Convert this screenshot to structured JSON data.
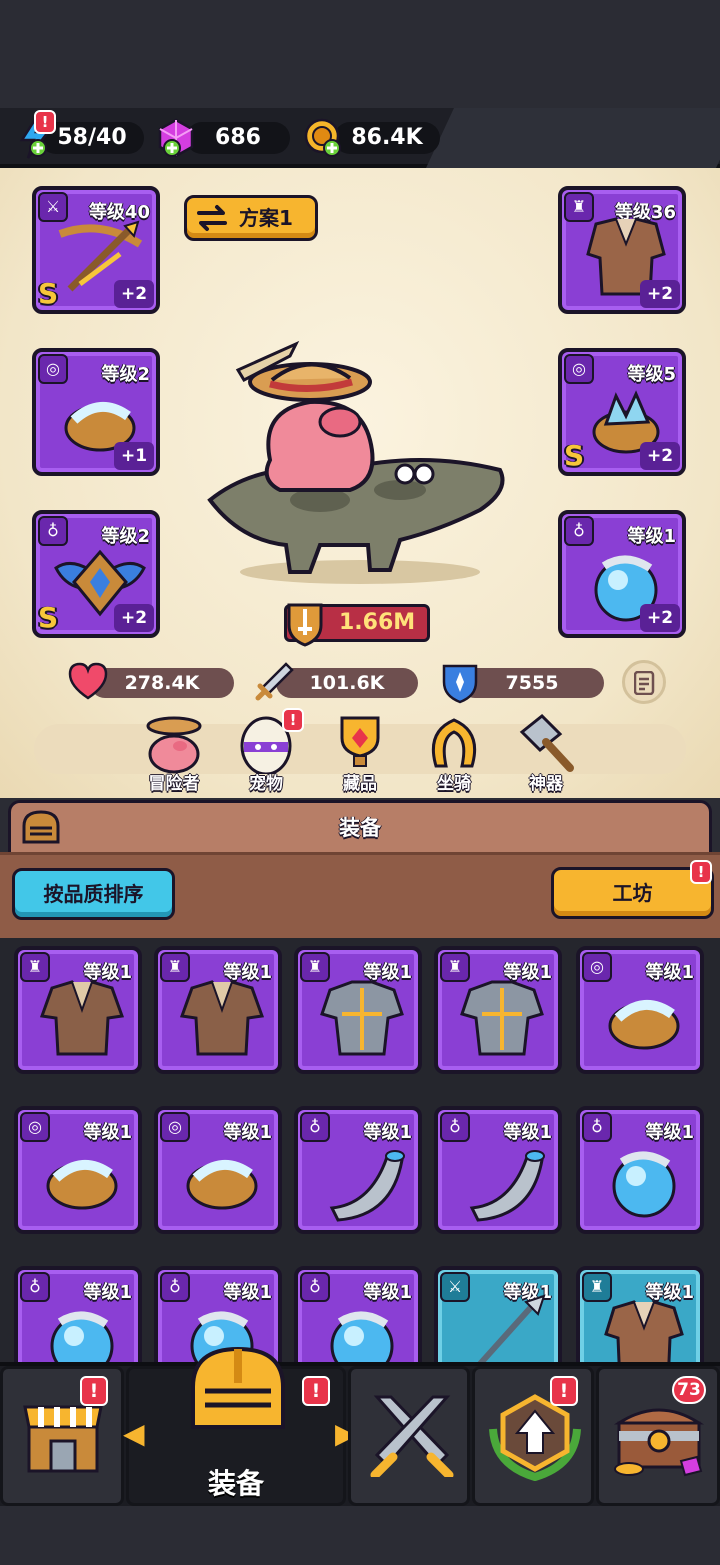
{
  "resources": {
    "energy": "58/40",
    "gems": "686",
    "gold": "86.4K"
  },
  "hero": {
    "plan_label": "方案1",
    "power": "1.66M",
    "stats": {
      "hp": "278.4K",
      "attack": "101.6K",
      "defense": "7555"
    }
  },
  "equipped": {
    "weapon": {
      "level": "等级40",
      "plus": "+2",
      "rank": "S"
    },
    "armor": {
      "level": "等级36",
      "plus": "+2"
    },
    "ring_left": {
      "level": "等级2",
      "plus": "+1"
    },
    "ring_right": {
      "level": "等级5",
      "plus": "+2",
      "rank": "S"
    },
    "amulet_left": {
      "level": "等级2",
      "plus": "+2",
      "rank": "S"
    },
    "amulet_right": {
      "level": "等级1",
      "plus": "+2"
    }
  },
  "menu": {
    "adventurer": "冒险者",
    "pet": "宠物",
    "collection": "藏品",
    "mount": "坐骑",
    "artifact": "神器"
  },
  "panel": {
    "title": "装备",
    "sort_button": "按品质排序",
    "workshop_button": "工坊"
  },
  "inventory": [
    {
      "level": "等级1"
    },
    {
      "level": "等级1"
    },
    {
      "level": "等级1"
    },
    {
      "level": "等级1"
    },
    {
      "level": "等级1"
    },
    {
      "level": "等级1"
    },
    {
      "level": "等级1"
    },
    {
      "level": "等级1"
    },
    {
      "level": "等级1"
    },
    {
      "level": "等级1"
    },
    {
      "level": "等级1"
    },
    {
      "level": "等级1"
    },
    {
      "level": "等级1"
    },
    {
      "level": "等级1"
    },
    {
      "level": "等级1"
    }
  ],
  "nav": {
    "active_label": "装备",
    "chest_count": "73",
    "alert": "!"
  }
}
